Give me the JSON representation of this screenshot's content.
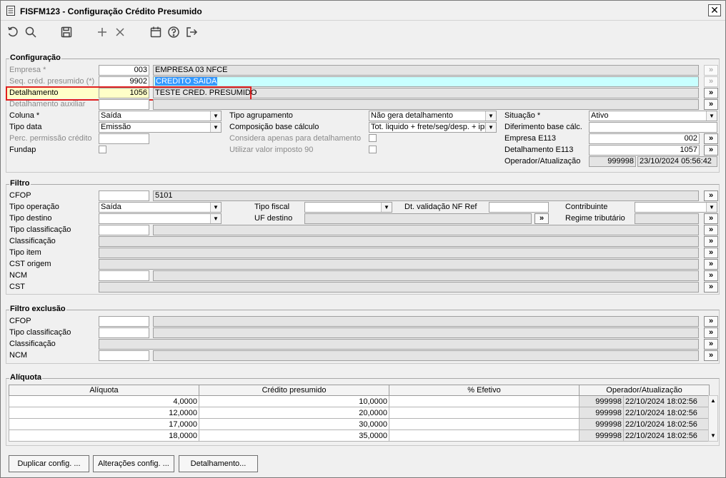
{
  "window": {
    "title": "FISFM123 - Configuração Crédito Presumido",
    "close": "✕"
  },
  "toolbar": {
    "icons": [
      "undo-icon",
      "search-icon",
      "save-icon",
      "add-icon",
      "delete-icon",
      "calendar-icon",
      "help-icon",
      "exit-icon"
    ]
  },
  "config": {
    "title": "Configuração",
    "empresa": {
      "label": "Empresa *",
      "code": "003",
      "desc": "EMPRESA 03 NFCE"
    },
    "seq": {
      "label": "Seq. créd. presumido (*)",
      "code": "9902",
      "desc": "CREDITO SAIDA"
    },
    "detalhamento": {
      "label": "Detalhamento",
      "code": "1056",
      "desc": "TESTE CRED. PRESUMIDO"
    },
    "detalhamento_aux": {
      "label": "Detalhamento auxiliar",
      "code": ""
    },
    "coluna": {
      "label": "Coluna *",
      "value": "Saída"
    },
    "tipo_data": {
      "label": "Tipo data",
      "value": "Emissão"
    },
    "perc_permissao": {
      "label": "Perc. permissão crédito",
      "value": ""
    },
    "fundap": {
      "label": "Fundap"
    },
    "tipo_agrupamento": {
      "label": "Tipo agrupamento",
      "value": "Não gera detalhamento"
    },
    "composicao": {
      "label": "Composição base cálculo",
      "value": "Tot. liquido + frete/seg/desp. + ipi"
    },
    "considera": {
      "label": "Considera apenas para detalhamento"
    },
    "utilizar": {
      "label": "Utilizar valor imposto 90"
    },
    "situacao": {
      "label": "Situação *",
      "value": "Ativo"
    },
    "diferimento": {
      "label": "Diferimento base cálc.",
      "value": ""
    },
    "empresa_e113": {
      "label": "Empresa E113",
      "value": "002"
    },
    "detalhamento_e113": {
      "label": "Detalhamento E113",
      "value": "1057"
    },
    "operador": {
      "label": "Operador/Atualização",
      "code": "999998",
      "datetime": "23/10/2024 05:56:42"
    }
  },
  "filtro": {
    "title": "Filtro",
    "cfop": {
      "label": "CFOP",
      "code": "",
      "desc": "5101"
    },
    "tipo_operacao": {
      "label": "Tipo operação",
      "value": "Saída"
    },
    "tipo_destino": {
      "label": "Tipo destino",
      "value": ""
    },
    "tipo_classificacao": {
      "label": "Tipo classificação"
    },
    "classificacao": {
      "label": "Classificação"
    },
    "tipo_item": {
      "label": "Tipo item"
    },
    "cst_origem": {
      "label": "CST origem"
    },
    "ncm": {
      "label": "NCM"
    },
    "cst": {
      "label": "CST"
    },
    "tipo_fiscal": {
      "label": "Tipo fiscal",
      "value": ""
    },
    "uf_destino": {
      "label": "UF destino"
    },
    "dt_validacao": {
      "label": "Dt. validação NF Ref",
      "value": ""
    },
    "contribuinte": {
      "label": "Contribuinte",
      "value": ""
    },
    "regime": {
      "label": "Regime tributário"
    }
  },
  "filtro_exclusao": {
    "title": "Filtro exclusão",
    "cfop": {
      "label": "CFOP"
    },
    "tipo_classificacao": {
      "label": "Tipo classificação"
    },
    "classificacao": {
      "label": "Classificação"
    },
    "ncm": {
      "label": "NCM"
    }
  },
  "aliquota": {
    "title": "Alíquota",
    "columns": [
      "Alíquota",
      "Crédito presumido",
      "% Efetivo",
      "Operador/Atualização"
    ],
    "rows": [
      {
        "aliquota": "4,0000",
        "credito": "10,0000",
        "efetivo": "",
        "operador": "999998",
        "data": "22/10/2024 18:02:56"
      },
      {
        "aliquota": "12,0000",
        "credito": "20,0000",
        "efetivo": "",
        "operador": "999998",
        "data": "22/10/2024 18:02:56"
      },
      {
        "aliquota": "17,0000",
        "credito": "30,0000",
        "efetivo": "",
        "operador": "999998",
        "data": "22/10/2024 18:02:56"
      },
      {
        "aliquota": "18,0000",
        "credito": "35,0000",
        "efetivo": "",
        "operador": "999998",
        "data": "22/10/2024 18:02:56"
      }
    ]
  },
  "buttons": {
    "duplicar": "Duplicar config. ...",
    "alteracoes": "Alterações config. ...",
    "detalhamento": "Detalhamento..."
  },
  "symbols": {
    "lookup": "»",
    "arrow": "▼"
  },
  "colors": {
    "highlight": "#3399ff",
    "redbox": "#e02020",
    "yellow_field": "#ffffc8",
    "cyan_field": "#c8ffff"
  }
}
